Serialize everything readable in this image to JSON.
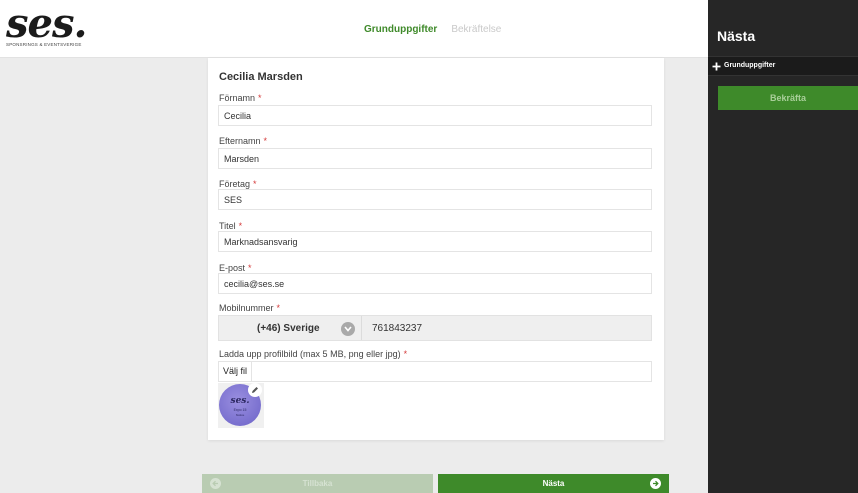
{
  "header": {
    "logo_text": "ses.",
    "logo_subtitle": "SPONSRINGS & EVENTSVERIGE",
    "steps": [
      {
        "label": "Grunduppgifter",
        "active": true
      },
      {
        "label": "Bekräftelse",
        "active": false
      }
    ]
  },
  "form": {
    "person_name": "Cecilia Marsden",
    "fields": [
      {
        "label": "Förnamn",
        "value": "Cecilia"
      },
      {
        "label": "Efternamn",
        "value": "Marsden"
      },
      {
        "label": "Företag",
        "value": "SES"
      },
      {
        "label": "Titel",
        "value": "Marknadsansvarig"
      },
      {
        "label": "E-post",
        "value": "cecilia@ses.se"
      }
    ],
    "required_mark": "*",
    "phone": {
      "label": "Mobilnummer",
      "country": "(+46) Sverige",
      "number": "761843237"
    },
    "upload": {
      "label": "Ladda upp profilbild (max 5 MB, png eller jpg)",
      "button": "Välj fil"
    },
    "avatar": {
      "logo_text": "ses.",
      "line1": "Expo 15",
      "line2": "Notice"
    }
  },
  "nav": {
    "back_label": "Tillbaka",
    "next_label": "Nästa"
  },
  "sidebar": {
    "title": "Nästa",
    "item_label": "Grunduppgifter",
    "confirm_label": "Bekräfta"
  },
  "colors": {
    "accent": "#3e8a2a",
    "sidebar_bg": "#262626",
    "required": "#d43a3a"
  }
}
